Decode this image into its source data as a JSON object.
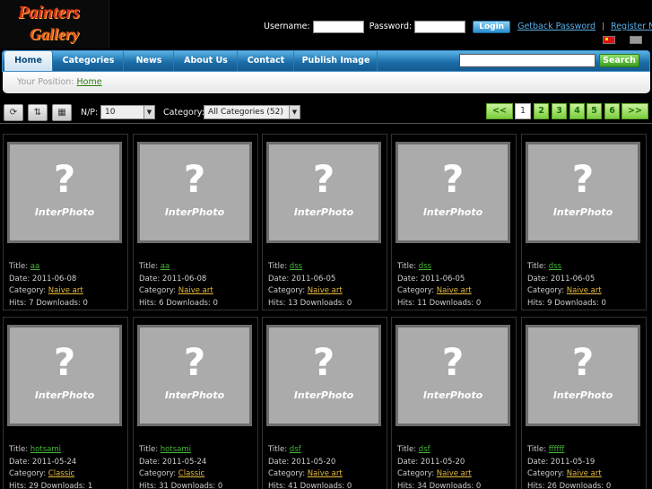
{
  "logo": {
    "line1": "Painters",
    "line2": "Gallery"
  },
  "login": {
    "username_label": "Username:",
    "password_label": "Password:",
    "username_value": "",
    "password_value": "",
    "login_button": "Login",
    "getback_link": "Getback Password",
    "separator": "|",
    "register_link": "Register Now?"
  },
  "nav": {
    "items": [
      "Home",
      "Categories",
      "News",
      "About Us",
      "Contact",
      "Publish Image"
    ],
    "search_value": "",
    "search_button": "Search"
  },
  "breadcrumb": {
    "prefix": "Your Position:",
    "link": "Home"
  },
  "toolbar": {
    "np_label": "N/P:",
    "np_value": "10",
    "category_label": "Category:",
    "category_value": "All Categories (52)",
    "pages": [
      "<<",
      "1",
      "2",
      "3",
      "4",
      "5",
      "6",
      ">>"
    ]
  },
  "thumb": {
    "placeholder": "?",
    "brand": "InterPhoto"
  },
  "labels": {
    "title": "Title:",
    "date": "Date:",
    "category": "Category:",
    "hits": "Hits:",
    "downloads": "Downloads:"
  },
  "items": [
    {
      "title": "aa",
      "date": "2011-06-08",
      "category": "Naive art",
      "hits": "7",
      "downloads": "0"
    },
    {
      "title": "aa",
      "date": "2011-06-08",
      "category": "Naive art",
      "hits": "6",
      "downloads": "0"
    },
    {
      "title": "dss",
      "date": "2011-06-05",
      "category": "Naive art",
      "hits": "13",
      "downloads": "0"
    },
    {
      "title": "dss",
      "date": "2011-06-05",
      "category": "Naive art",
      "hits": "11",
      "downloads": "0"
    },
    {
      "title": "dss",
      "date": "2011-06-05",
      "category": "Naive art",
      "hits": "9",
      "downloads": "0"
    },
    {
      "title": "hotsami",
      "date": "2011-05-24",
      "category": "Classic",
      "hits": "29",
      "downloads": "1"
    },
    {
      "title": "hotsami",
      "date": "2011-05-24",
      "category": "Classic",
      "hits": "31",
      "downloads": "0"
    },
    {
      "title": "dsf",
      "date": "2011-05-20",
      "category": "Naive art",
      "hits": "41",
      "downloads": "0"
    },
    {
      "title": "dsf",
      "date": "2011-05-20",
      "category": "Naive art",
      "hits": "34",
      "downloads": "0"
    },
    {
      "title": "ffffff",
      "date": "2011-05-19",
      "category": "Naive art",
      "hits": "26",
      "downloads": "0"
    }
  ]
}
